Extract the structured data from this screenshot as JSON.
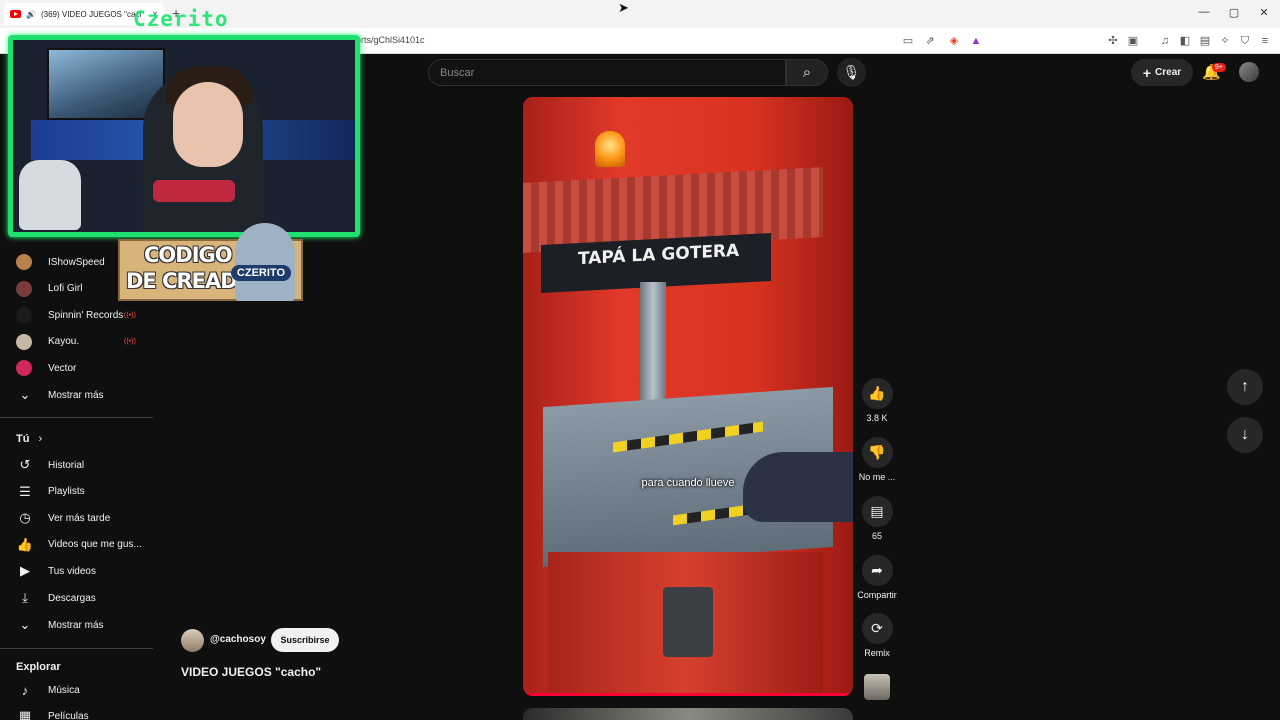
{
  "browser": {
    "tab_title": "(369) VIDEO JUEGOS \"cacho\"",
    "tab_close": "×",
    "new_tab": "+",
    "url_visible": "orts/gChlSi4101c",
    "window_controls": {
      "minimize": "—",
      "maximize": "▢",
      "close": "✕"
    }
  },
  "overlay": {
    "streamer_name": "Czerito",
    "creator_code_line1": "CODIGO",
    "creator_code_line2": "DE CREADOR",
    "creator_code_badge": "CZERITO"
  },
  "sidebar": {
    "subscriptions": [
      {
        "label": "IShowSpeed",
        "live": false,
        "color": "#b8824e"
      },
      {
        "label": "Lofi Girl",
        "live": false,
        "color": "#7a3b3b"
      },
      {
        "label": "Spinnin' Records",
        "live": true,
        "color": "#1a1a1a"
      },
      {
        "label": "Kayou.",
        "live": true,
        "color": "#c7b8a8"
      },
      {
        "label": "Vector",
        "live": false,
        "color": "#d02858"
      }
    ],
    "show_more_1": "Mostrar más",
    "you_title": "Tú",
    "you_items": [
      {
        "label": "Historial",
        "icon": "history-icon"
      },
      {
        "label": "Playlists",
        "icon": "playlists-icon"
      },
      {
        "label": "Ver más tarde",
        "icon": "watch-later-icon"
      },
      {
        "label": "Videos que me gus...",
        "icon": "like-icon"
      },
      {
        "label": "Tus videos",
        "icon": "your-videos-icon"
      },
      {
        "label": "Descargas",
        "icon": "download-icon"
      }
    ],
    "show_more_2": "Mostrar más",
    "explore_title": "Explorar",
    "explore_items": [
      {
        "label": "Música",
        "icon": "music-icon"
      },
      {
        "label": "Películas",
        "icon": "movies-icon"
      }
    ]
  },
  "header": {
    "search_placeholder": "Buscar",
    "create_label": "Crear",
    "notifications_badge": "9+"
  },
  "video": {
    "banner_text": "TAPÁ LA GOTERA",
    "caption": "para cuando llueve",
    "progress_fraction": 1.0
  },
  "actions": {
    "like_count": "3.8 K",
    "dislike_label": "No me ...",
    "comments_count": "65",
    "share_label": "Compartir",
    "remix_label": "Remix"
  },
  "channel": {
    "handle": "@cachosoy",
    "subscribe_label": "Suscribirse",
    "video_title": "VIDEO JUEGOS \"cacho\""
  },
  "colors": {
    "accent_green": "#20e070",
    "youtube_red": "#ff0000",
    "background": "#0f0f0f"
  }
}
